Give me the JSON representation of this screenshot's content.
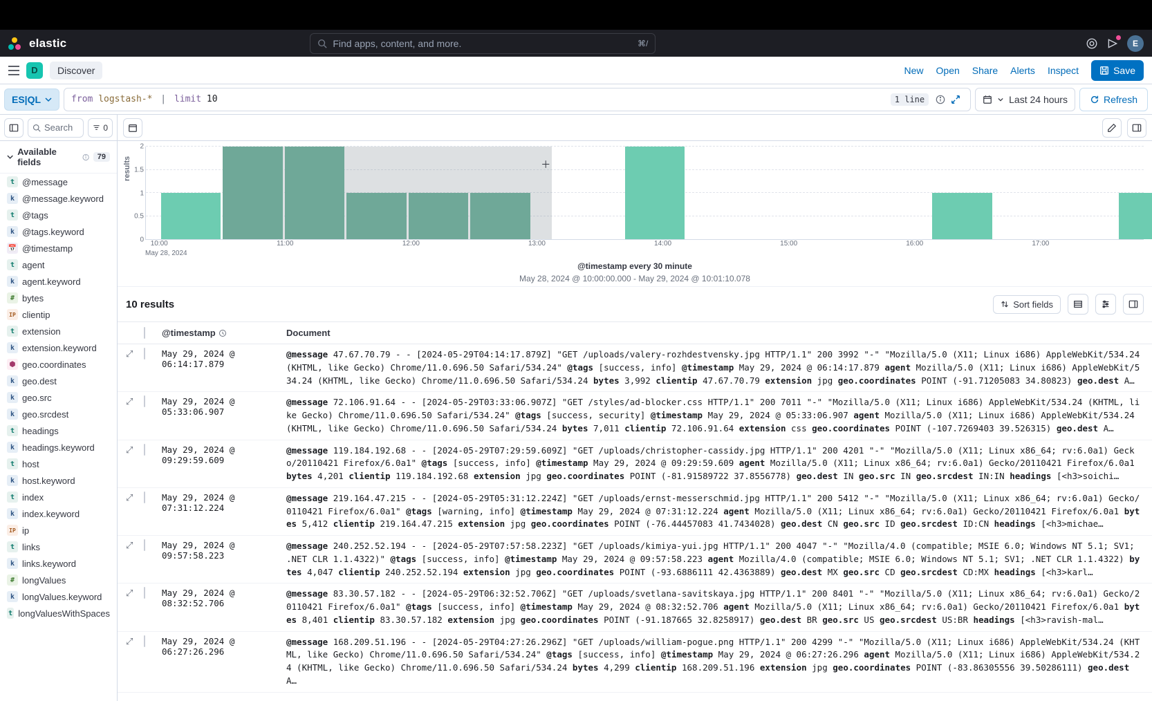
{
  "brand": "elastic",
  "global_search": {
    "placeholder": "Find apps, content, and more.",
    "shortcut": "⌘/"
  },
  "avatar_initial": "E",
  "app_badge_letter": "D",
  "breadcrumb": "Discover",
  "actions": {
    "new": "New",
    "open": "Open",
    "share": "Share",
    "alerts": "Alerts",
    "inspect": "Inspect",
    "save": "Save"
  },
  "query": {
    "language": "ES|QL",
    "text_kw": "from",
    "text_arg": "logstash-*",
    "text_pipe": "|",
    "text_kw2": "limit",
    "text_num": "10",
    "lines_badge": "1 line"
  },
  "datepicker": {
    "label": "Last 24 hours"
  },
  "refresh_label": "Refresh",
  "sidebar": {
    "search_placeholder": "Search",
    "filter_count": "0",
    "section_title": "Available fields",
    "section_count": "79",
    "fields": [
      {
        "type": "t",
        "name": "@message"
      },
      {
        "type": "k",
        "name": "@message.keyword"
      },
      {
        "type": "t",
        "name": "@tags"
      },
      {
        "type": "k",
        "name": "@tags.keyword"
      },
      {
        "type": "d",
        "name": "@timestamp"
      },
      {
        "type": "t",
        "name": "agent"
      },
      {
        "type": "k",
        "name": "agent.keyword"
      },
      {
        "type": "n",
        "name": "bytes"
      },
      {
        "type": "ip",
        "name": "clientip"
      },
      {
        "type": "t",
        "name": "extension"
      },
      {
        "type": "k",
        "name": "extension.keyword"
      },
      {
        "type": "g",
        "name": "geo.coordinates"
      },
      {
        "type": "k",
        "name": "geo.dest"
      },
      {
        "type": "k",
        "name": "geo.src"
      },
      {
        "type": "k",
        "name": "geo.srcdest"
      },
      {
        "type": "t",
        "name": "headings"
      },
      {
        "type": "k",
        "name": "headings.keyword"
      },
      {
        "type": "t",
        "name": "host"
      },
      {
        "type": "k",
        "name": "host.keyword"
      },
      {
        "type": "t",
        "name": "index"
      },
      {
        "type": "k",
        "name": "index.keyword"
      },
      {
        "type": "ip",
        "name": "ip"
      },
      {
        "type": "t",
        "name": "links"
      },
      {
        "type": "k",
        "name": "links.keyword"
      },
      {
        "type": "n",
        "name": "longValues"
      },
      {
        "type": "k",
        "name": "longValues.keyword"
      },
      {
        "type": "t",
        "name": "longValuesWithSpaces"
      }
    ]
  },
  "chart_data": {
    "type": "bar",
    "ylabel": "results",
    "yticks": [
      0,
      0.5,
      1,
      1.5,
      2
    ],
    "ylim": [
      0,
      2
    ],
    "xticks": [
      "10:00",
      "11:00",
      "12:00",
      "13:00",
      "14:00",
      "15:00",
      "16:00",
      "17:00"
    ],
    "x_date": "May 28, 2024",
    "bars": [
      {
        "center_pct": 4.5,
        "width_pct": 6.0,
        "value": 1,
        "selected": false
      },
      {
        "center_pct": 10.7,
        "width_pct": 6.0,
        "value": 2,
        "selected": true
      },
      {
        "center_pct": 16.9,
        "width_pct": 6.0,
        "value": 2,
        "selected": true
      },
      {
        "center_pct": 23.1,
        "width_pct": 6.0,
        "value": 1,
        "selected": true
      },
      {
        "center_pct": 29.3,
        "width_pct": 6.0,
        "value": 1,
        "selected": true
      },
      {
        "center_pct": 35.5,
        "width_pct": 6.0,
        "value": 1,
        "selected": true
      },
      {
        "center_pct": 51.0,
        "width_pct": 6.0,
        "value": 2,
        "selected": false
      },
      {
        "center_pct": 81.8,
        "width_pct": 6.0,
        "value": 1,
        "selected": false
      },
      {
        "center_pct": 100.5,
        "width_pct": 6.0,
        "value": 1,
        "selected": false
      }
    ],
    "brush": {
      "left_pct": 7.7,
      "width_pct": 33.0
    },
    "crosshair_pct": 40.0,
    "xlabel": "@timestamp every 30 minute",
    "range_text": "May 28, 2024 @ 10:00:00.000 - May 29, 2024 @ 10:01:10.078"
  },
  "results": {
    "title": "10 results",
    "sort_label": "Sort fields",
    "columns": {
      "timestamp": "@timestamp",
      "document": "Document"
    },
    "rows": [
      {
        "ts": "May 29, 2024 @ 06:14:17.879",
        "doc": [
          {
            "k": "@message",
            "v": "47.67.70.79 - - [2024-05-29T04:14:17.879Z] \"GET /uploads/valery-rozhdestvensky.jpg HTTP/1.1\" 200 3992 \"-\" \"Mozilla/5.0 (X11; Linux i686) AppleWebKit/534.24 (KHTML, like Gecko) Chrome/11.0.696.50 Safari/534.24\""
          },
          {
            "k": "@tags",
            "v": "[success, info]"
          },
          {
            "k": "@timestamp",
            "v": "May 29, 2024 @ 06:14:17.879"
          },
          {
            "k": "agent",
            "v": "Mozilla/5.0 (X11; Linux i686) AppleWebKit/534.24 (KHTML, like Gecko) Chrome/11.0.696.50 Safari/534.24"
          },
          {
            "k": "bytes",
            "v": "3,992"
          },
          {
            "k": "clientip",
            "v": "47.67.70.79"
          },
          {
            "k": "extension",
            "v": "jpg"
          },
          {
            "k": "geo.coordinates",
            "v": "POINT (-91.71205083 34.80823)"
          },
          {
            "k": "geo.dest",
            "v": "A…"
          }
        ]
      },
      {
        "ts": "May 29, 2024 @ 05:33:06.907",
        "doc": [
          {
            "k": "@message",
            "v": "72.106.91.64 - - [2024-05-29T03:33:06.907Z] \"GET /styles/ad-blocker.css HTTP/1.1\" 200 7011 \"-\" \"Mozilla/5.0 (X11; Linux i686) AppleWebKit/534.24 (KHTML, like Gecko) Chrome/11.0.696.50 Safari/534.24\""
          },
          {
            "k": "@tags",
            "v": "[success, security]"
          },
          {
            "k": "@timestamp",
            "v": "May 29, 2024 @ 05:33:06.907"
          },
          {
            "k": "agent",
            "v": "Mozilla/5.0 (X11; Linux i686) AppleWebKit/534.24 (KHTML, like Gecko) Chrome/11.0.696.50 Safari/534.24"
          },
          {
            "k": "bytes",
            "v": "7,011"
          },
          {
            "k": "clientip",
            "v": "72.106.91.64"
          },
          {
            "k": "extension",
            "v": "css"
          },
          {
            "k": "geo.coordinates",
            "v": "POINT (-107.7269403 39.526315)"
          },
          {
            "k": "geo.dest",
            "v": "A…"
          }
        ]
      },
      {
        "ts": "May 29, 2024 @ 09:29:59.609",
        "doc": [
          {
            "k": "@message",
            "v": "119.184.192.68 - - [2024-05-29T07:29:59.609Z] \"GET /uploads/christopher-cassidy.jpg HTTP/1.1\" 200 4201 \"-\" \"Mozilla/5.0 (X11; Linux x86_64; rv:6.0a1) Gecko/20110421 Firefox/6.0a1\""
          },
          {
            "k": "@tags",
            "v": "[success, info]"
          },
          {
            "k": "@timestamp",
            "v": "May 29, 2024 @ 09:29:59.609"
          },
          {
            "k": "agent",
            "v": "Mozilla/5.0 (X11; Linux x86_64; rv:6.0a1) Gecko/20110421 Firefox/6.0a1"
          },
          {
            "k": "bytes",
            "v": "4,201"
          },
          {
            "k": "clientip",
            "v": "119.184.192.68"
          },
          {
            "k": "extension",
            "v": "jpg"
          },
          {
            "k": "geo.coordinates",
            "v": "POINT (-81.91589722 37.8556778)"
          },
          {
            "k": "geo.dest",
            "v": "IN"
          },
          {
            "k": "geo.src",
            "v": "IN"
          },
          {
            "k": "geo.srcdest",
            "v": "IN:IN"
          },
          {
            "k": "headings",
            "v": "[<h3>soichi…"
          }
        ]
      },
      {
        "ts": "May 29, 2024 @ 07:31:12.224",
        "doc": [
          {
            "k": "@message",
            "v": "219.164.47.215 - - [2024-05-29T05:31:12.224Z] \"GET /uploads/ernst-messerschmid.jpg HTTP/1.1\" 200 5412 \"-\" \"Mozilla/5.0 (X11; Linux x86_64; rv:6.0a1) Gecko/0110421 Firefox/6.0a1\""
          },
          {
            "k": "@tags",
            "v": "[warning, info]"
          },
          {
            "k": "@timestamp",
            "v": "May 29, 2024 @ 07:31:12.224"
          },
          {
            "k": "agent",
            "v": "Mozilla/5.0 (X11; Linux x86_64; rv:6.0a1) Gecko/20110421 Firefox/6.0a1"
          },
          {
            "k": "bytes",
            "v": "5,412"
          },
          {
            "k": "clientip",
            "v": "219.164.47.215"
          },
          {
            "k": "extension",
            "v": "jpg"
          },
          {
            "k": "geo.coordinates",
            "v": "POINT (-76.44457083 41.7434028)"
          },
          {
            "k": "geo.dest",
            "v": "CN"
          },
          {
            "k": "geo.src",
            "v": "ID"
          },
          {
            "k": "geo.srcdest",
            "v": "ID:CN"
          },
          {
            "k": "headings",
            "v": "[<h3>michae…"
          }
        ]
      },
      {
        "ts": "May 29, 2024 @ 09:57:58.223",
        "doc": [
          {
            "k": "@message",
            "v": "240.252.52.194 - - [2024-05-29T07:57:58.223Z] \"GET /uploads/kimiya-yui.jpg HTTP/1.1\" 200 4047 \"-\" \"Mozilla/4.0 (compatible; MSIE 6.0; Windows NT 5.1; SV1; .NET CLR 1.1.4322)\""
          },
          {
            "k": "@tags",
            "v": "[success, info]"
          },
          {
            "k": "@timestamp",
            "v": "May 29, 2024 @ 09:57:58.223"
          },
          {
            "k": "agent",
            "v": "Mozilla/4.0 (compatible; MSIE 6.0; Windows NT 5.1; SV1; .NET CLR 1.1.4322)"
          },
          {
            "k": "bytes",
            "v": "4,047"
          },
          {
            "k": "clientip",
            "v": "240.252.52.194"
          },
          {
            "k": "extension",
            "v": "jpg"
          },
          {
            "k": "geo.coordinates",
            "v": "POINT (-93.6886111 42.4363889)"
          },
          {
            "k": "geo.dest",
            "v": "MX"
          },
          {
            "k": "geo.src",
            "v": "CD"
          },
          {
            "k": "geo.srcdest",
            "v": "CD:MX"
          },
          {
            "k": "headings",
            "v": "[<h3>karl…"
          }
        ]
      },
      {
        "ts": "May 29, 2024 @ 08:32:52.706",
        "doc": [
          {
            "k": "@message",
            "v": "83.30.57.182 - - [2024-05-29T06:32:52.706Z] \"GET /uploads/svetlana-savitskaya.jpg HTTP/1.1\" 200 8401 \"-\" \"Mozilla/5.0 (X11; Linux x86_64; rv:6.0a1) Gecko/20110421 Firefox/6.0a1\""
          },
          {
            "k": "@tags",
            "v": "[success, info]"
          },
          {
            "k": "@timestamp",
            "v": "May 29, 2024 @ 08:32:52.706"
          },
          {
            "k": "agent",
            "v": "Mozilla/5.0 (X11; Linux x86_64; rv:6.0a1) Gecko/20110421 Firefox/6.0a1"
          },
          {
            "k": "bytes",
            "v": "8,401"
          },
          {
            "k": "clientip",
            "v": "83.30.57.182"
          },
          {
            "k": "extension",
            "v": "jpg"
          },
          {
            "k": "geo.coordinates",
            "v": "POINT (-91.187665 32.8258917)"
          },
          {
            "k": "geo.dest",
            "v": "BR"
          },
          {
            "k": "geo.src",
            "v": "US"
          },
          {
            "k": "geo.srcdest",
            "v": "US:BR"
          },
          {
            "k": "headings",
            "v": "[<h3>ravish-mal…"
          }
        ]
      },
      {
        "ts": "May 29, 2024 @ 06:27:26.296",
        "doc": [
          {
            "k": "@message",
            "v": "168.209.51.196 - - [2024-05-29T04:27:26.296Z] \"GET /uploads/william-pogue.png HTTP/1.1\" 200 4299 \"-\" \"Mozilla/5.0 (X11; Linux i686) AppleWebKit/534.24 (KHTML, like Gecko) Chrome/11.0.696.50 Safari/534.24\""
          },
          {
            "k": "@tags",
            "v": "[success, info]"
          },
          {
            "k": "@timestamp",
            "v": "May 29, 2024 @ 06:27:26.296"
          },
          {
            "k": "agent",
            "v": "Mozilla/5.0 (X11; Linux i686) AppleWebKit/534.24 (KHTML, like Gecko) Chrome/11.0.696.50 Safari/534.24"
          },
          {
            "k": "bytes",
            "v": "4,299"
          },
          {
            "k": "clientip",
            "v": "168.209.51.196"
          },
          {
            "k": "extension",
            "v": "jpg"
          },
          {
            "k": "geo.coordinates",
            "v": "POINT (-83.86305556 39.50286111)"
          },
          {
            "k": "geo.dest",
            "v": "A…"
          }
        ]
      }
    ]
  }
}
